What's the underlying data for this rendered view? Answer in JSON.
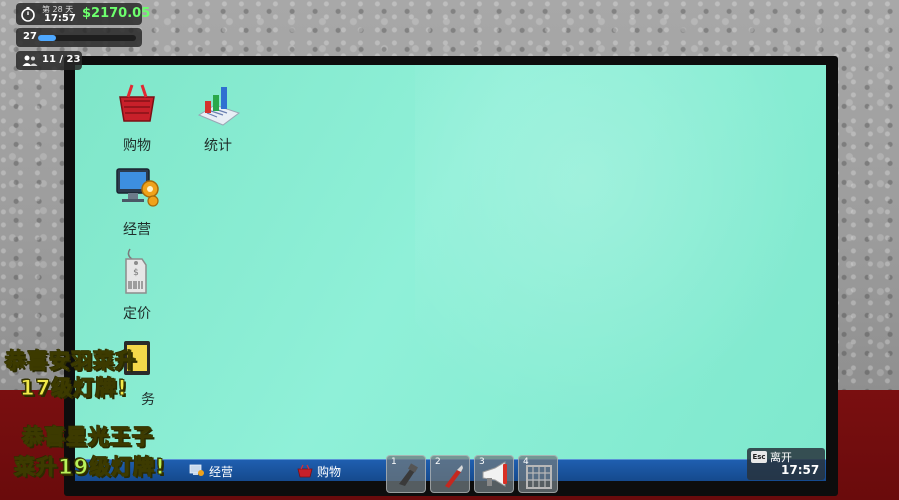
{
  "hud": {
    "day": "第 28 天",
    "time": "17:57",
    "money": "$2170.05",
    "level": "27",
    "level_progress": 0.18,
    "customers": "11 / 23"
  },
  "desktop": {
    "icons": [
      {
        "label": "购物",
        "icon": "shopping-basket-icon"
      },
      {
        "label": "统计",
        "icon": "bar-chart-icon"
      },
      {
        "label": "经营",
        "icon": "monitor-gear-icon"
      },
      {
        "label": "定价",
        "icon": "price-tag-icon"
      },
      {
        "label": "务",
        "icon": "clipboard-icon"
      }
    ]
  },
  "taskbar": {
    "items": [
      {
        "label": "经营",
        "icon": "monitor-gear-icon"
      },
      {
        "label": "购物",
        "icon": "shopping-basket-icon"
      }
    ],
    "esc": {
      "key": "Esc",
      "label": "离开",
      "time": "17:57"
    }
  },
  "hotbar": {
    "slots": [
      {
        "num": "1",
        "icon": "scanner-icon"
      },
      {
        "num": "2",
        "icon": "box-cutter-icon"
      },
      {
        "num": "3",
        "icon": "megaphone-icon"
      },
      {
        "num": "4",
        "icon": "shelf-icon"
      }
    ]
  },
  "overlays": {
    "msg1_line1": "恭喜安羽菜升",
    "msg1_line2": "17级灯牌!",
    "msg2_line1": "恭喜星光王子",
    "msg2_line2": "菜升19级灯牌!"
  },
  "colors": {
    "screen": "#8ff0d8",
    "money_green": "#6dff6d",
    "taskbar": "#1f5fb0",
    "overlay_fill": "#f2e94a",
    "overlay_fill_green": "#b9f25a"
  }
}
